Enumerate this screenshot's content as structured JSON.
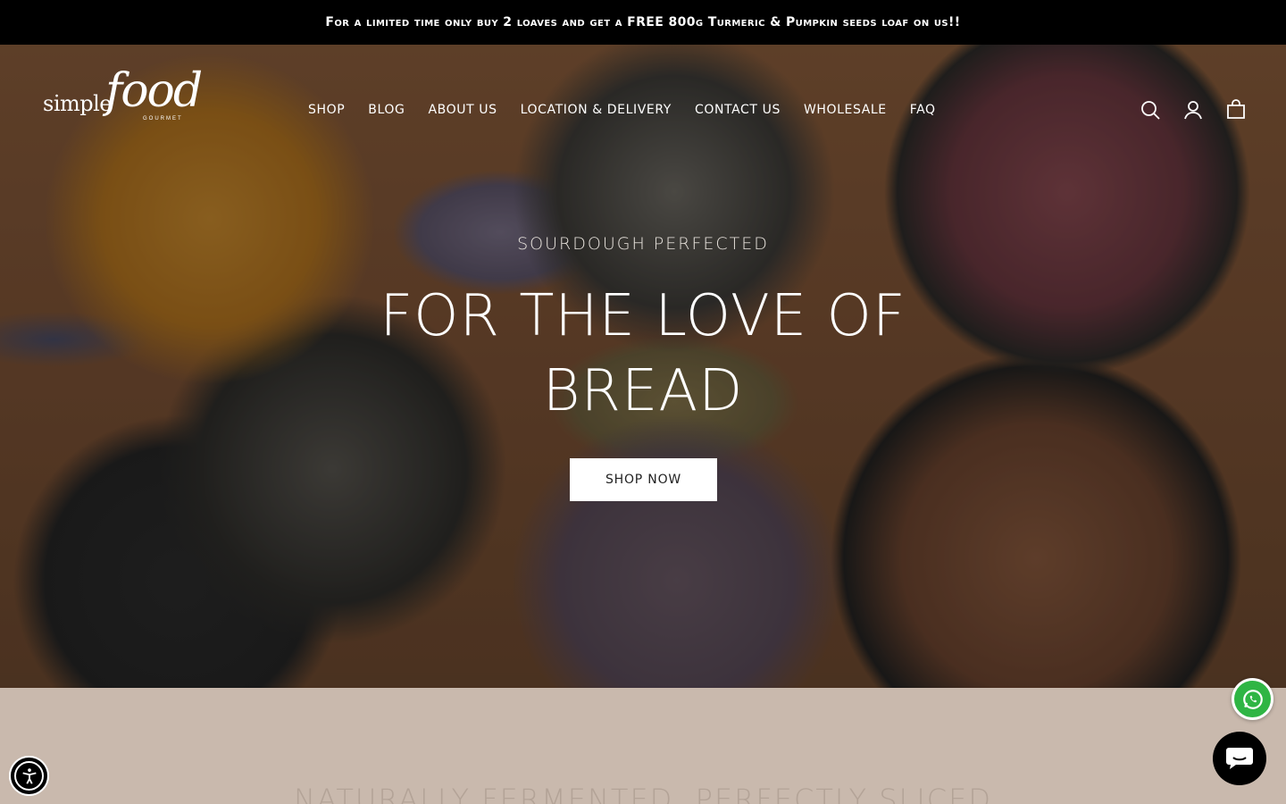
{
  "announcement": {
    "text": "For a limited time only buy 2 loaves and get a FREE 800g Turmeric & Pumpkin seeds loaf on us!!"
  },
  "header": {
    "logo": {
      "word": "simple",
      "script": "food",
      "sub": "GOURMET"
    },
    "nav": [
      {
        "label": "SHOP"
      },
      {
        "label": "BLOG"
      },
      {
        "label": "ABOUT US"
      },
      {
        "label": "LOCATION & DELIVERY"
      },
      {
        "label": "CONTACT US"
      },
      {
        "label": "WHOLESALE"
      },
      {
        "label": "FAQ"
      }
    ],
    "icons": [
      "search-icon",
      "account-icon",
      "cart-icon"
    ]
  },
  "hero": {
    "subheading": "SOURDOUGH PERFECTED",
    "title": "FOR THE LOVE OF BREAD",
    "cta_label": "SHOP NOW"
  },
  "section2": {
    "title": "NATURALLY FERMENTED, PERFECTLY SLICED"
  },
  "widgets": {
    "whatsapp_icon": "whatsapp-icon",
    "chat_icon": "chat-icon",
    "accessibility_icon": "accessibility-icon"
  },
  "colors": {
    "announcement_bg": "#000000",
    "section_bg": "#c9b9ad",
    "whatsapp_green": "#2fb544",
    "cta_bg": "#ffffff"
  }
}
